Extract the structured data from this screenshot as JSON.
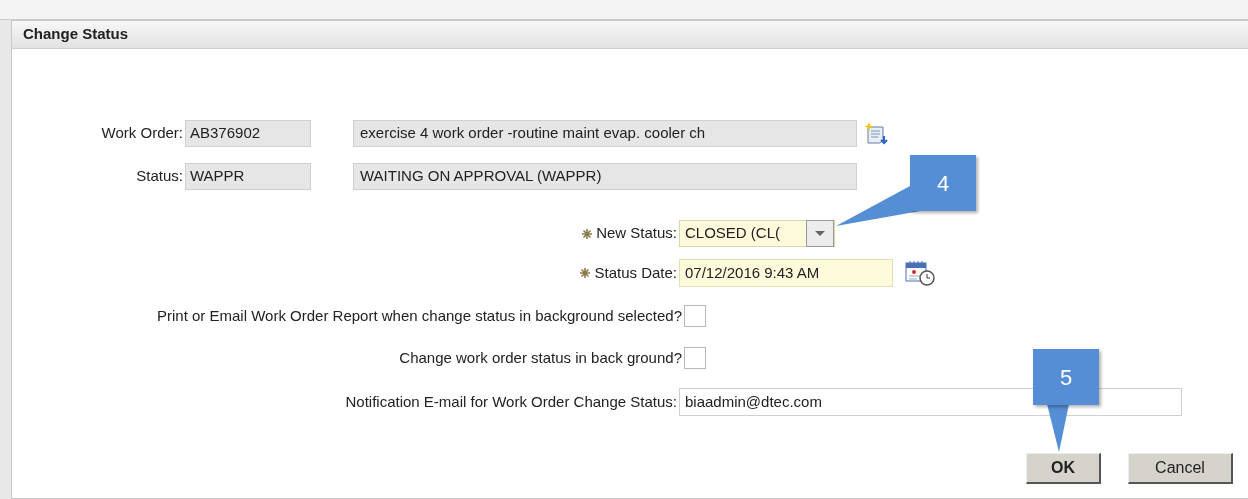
{
  "dialog": {
    "title": "Change Status"
  },
  "work_order": {
    "label": "Work Order:",
    "value": "AB376902",
    "description": "exercise 4 work order -routine maint evap. cooler ch"
  },
  "status": {
    "label": "Status:",
    "value": "WAPPR",
    "description": "WAITING ON APPROVAL (WAPPR)"
  },
  "new_status": {
    "label": "New Status:",
    "required": true,
    "value": "CLOSED (CL("
  },
  "status_date": {
    "label": "Status Date:",
    "required": true,
    "value": "07/12/2016 9:43 AM"
  },
  "checkboxes": [
    {
      "label": "Print or Email Work Order Report when change status in background selected?",
      "checked": false
    },
    {
      "label": "Change work order status in back ground?",
      "checked": false
    }
  ],
  "notification": {
    "label": "Notification E-mail for Work Order Change Status:",
    "value": "biaadmin@dtec.com"
  },
  "buttons": [
    {
      "label": "OK",
      "default": true
    },
    {
      "label": "Cancel",
      "default": false
    }
  ],
  "callouts": [
    {
      "number": "4"
    },
    {
      "number": "5"
    }
  ]
}
